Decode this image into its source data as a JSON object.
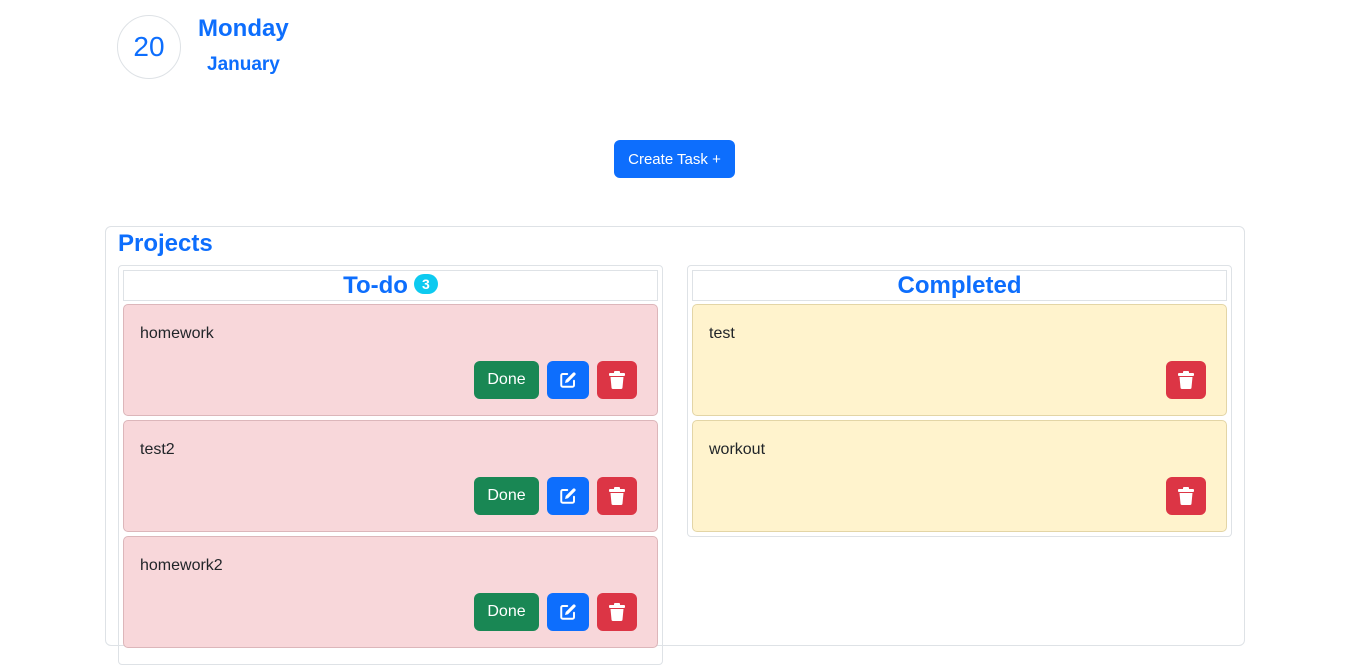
{
  "date": {
    "day_number": "20",
    "weekday": "Monday",
    "month": "January"
  },
  "create_button": {
    "label": "Create Task +"
  },
  "projects": {
    "title": "Projects",
    "todo": {
      "title": "To-do",
      "count": "3",
      "done_label": "Done",
      "tasks": [
        {
          "text": "homework"
        },
        {
          "text": "test2"
        },
        {
          "text": "homework2"
        }
      ]
    },
    "completed": {
      "title": "Completed",
      "tasks": [
        {
          "text": "test"
        },
        {
          "text": "workout"
        }
      ]
    }
  },
  "icons": {
    "edit": "edit-square-pencil",
    "delete": "trash-can"
  },
  "colors": {
    "primary": "#0d6efd",
    "success": "#198754",
    "danger": "#dc3545",
    "info": "#0dcaf0",
    "todo_card_bg": "#f8d7da",
    "completed_card_bg": "#fff3cd"
  }
}
